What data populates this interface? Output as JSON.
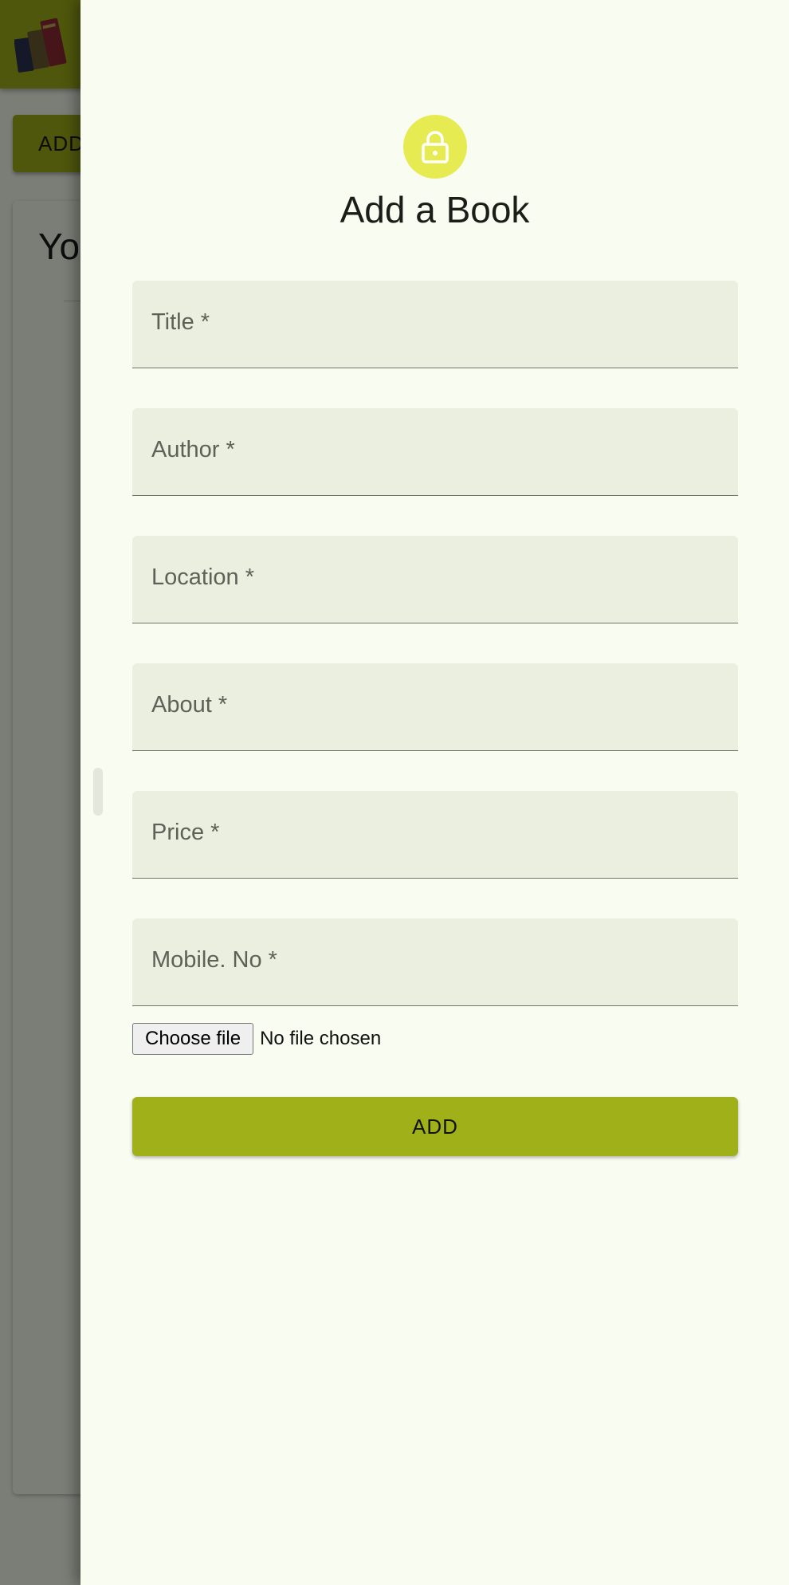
{
  "background": {
    "add_button_label": "ADD",
    "card_heading": "Yo"
  },
  "drawer": {
    "title": "Add a Book",
    "fields": [
      {
        "label": "Title *"
      },
      {
        "label": "Author *"
      },
      {
        "label": "Location *"
      },
      {
        "label": "About *"
      },
      {
        "label": "Price *"
      },
      {
        "label": "Mobile. No *"
      }
    ],
    "file_input": {
      "button_label": "Choose file",
      "status": "No file chosen"
    },
    "submit_label": "ADD"
  },
  "colors": {
    "brand": "#9fae18",
    "lock_avatar": "#e6eb52",
    "drawer_background": "#f9fcf1",
    "field_fill": "#ebefe0"
  },
  "icons": {
    "app_logo": "books-logo",
    "avatar": "lock-icon"
  }
}
